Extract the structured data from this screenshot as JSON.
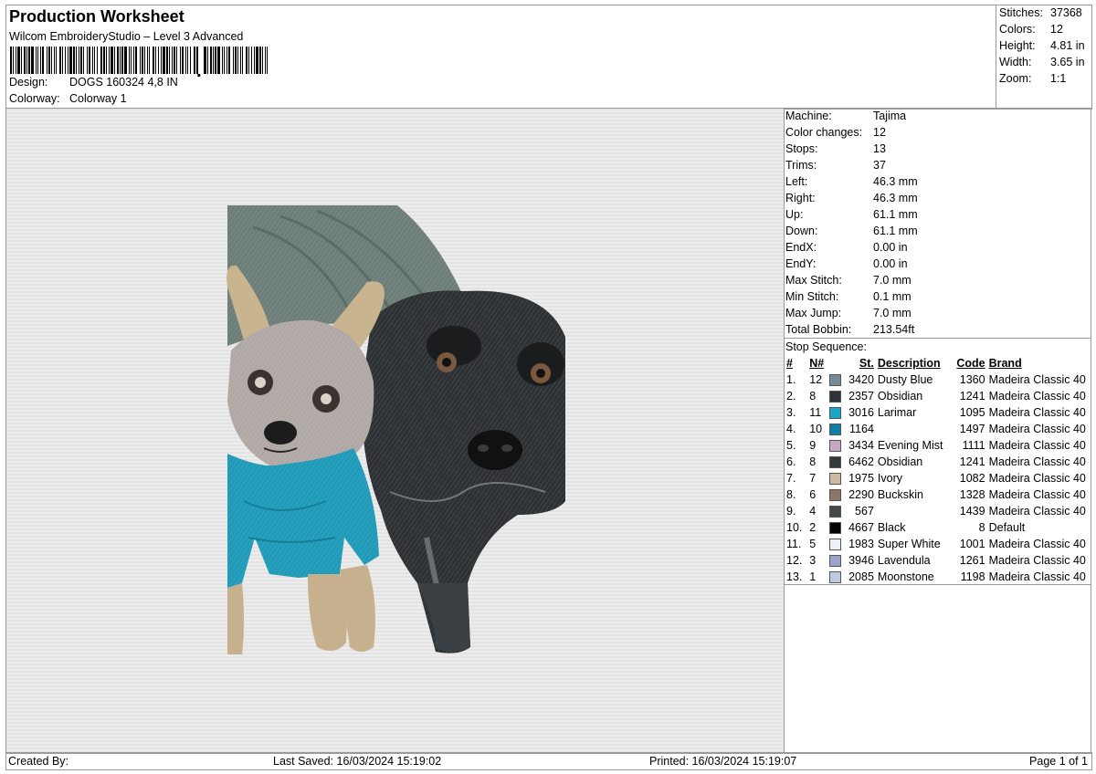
{
  "header": {
    "title": "Production Worksheet",
    "subtitle": "Wilcom EmbroideryStudio – Level 3 Advanced",
    "design_label": "Design:",
    "design_value": "DOGS 160324 4,8 IN",
    "colorway_label": "Colorway:",
    "colorway_value": "Colorway 1"
  },
  "stats": [
    {
      "label": "Stitches:",
      "value": "37368"
    },
    {
      "label": "Colors:",
      "value": "12"
    },
    {
      "label": "Height:",
      "value": "4.81 in"
    },
    {
      "label": "Width:",
      "value": "3.65 in"
    },
    {
      "label": "Zoom:",
      "value": "1:1"
    }
  ],
  "machine": [
    {
      "label": "Machine:",
      "value": "Tajima"
    },
    {
      "label": "Color changes:",
      "value": "12"
    },
    {
      "label": "Stops:",
      "value": "13"
    },
    {
      "label": "Trims:",
      "value": "37"
    },
    {
      "label": "Left:",
      "value": "46.3 mm"
    },
    {
      "label": "Right:",
      "value": "46.3 mm"
    },
    {
      "label": "Up:",
      "value": "61.1 mm"
    },
    {
      "label": "Down:",
      "value": "61.1 mm"
    },
    {
      "label": "EndX:",
      "value": "0.00 in"
    },
    {
      "label": "EndY:",
      "value": "0.00 in"
    },
    {
      "label": "Max Stitch:",
      "value": "7.0 mm"
    },
    {
      "label": "Min Stitch:",
      "value": "0.1 mm"
    },
    {
      "label": "Max Jump:",
      "value": "7.0 mm"
    },
    {
      "label": "Total Bobbin:",
      "value": "213.54ft"
    }
  ],
  "sequence": {
    "title": "Stop Sequence:",
    "headers": {
      "num": "#",
      "n": "N#",
      "st": "St.",
      "desc": "Description",
      "code": "Code",
      "brand": "Brand"
    },
    "rows": [
      {
        "num": "1.",
        "n": "12",
        "color": "#7a8a96",
        "st": "3420",
        "desc": "Dusty Blue",
        "code": "1360",
        "brand": "Madeira Classic 40"
      },
      {
        "num": "2.",
        "n": "8",
        "color": "#2f3436",
        "st": "2357",
        "desc": "Obsidian",
        "code": "1241",
        "brand": "Madeira Classic 40"
      },
      {
        "num": "3.",
        "n": "11",
        "color": "#19a6c7",
        "st": "3016",
        "desc": "Larimar",
        "code": "1095",
        "brand": "Madeira Classic 40"
      },
      {
        "num": "4.",
        "n": "10",
        "color": "#0f7fa6",
        "st": "1164",
        "desc": "",
        "code": "1497",
        "brand": "Madeira Classic 40"
      },
      {
        "num": "5.",
        "n": "9",
        "color": "#c4a8c6",
        "st": "3434",
        "desc": "Evening Mist",
        "code": "1111",
        "brand": "Madeira Classic 40"
      },
      {
        "num": "6.",
        "n": "8",
        "color": "#33383a",
        "st": "6462",
        "desc": "Obsidian",
        "code": "1241",
        "brand": "Madeira Classic 40"
      },
      {
        "num": "7.",
        "n": "7",
        "color": "#cdb8a2",
        "st": "1975",
        "desc": "Ivory",
        "code": "1082",
        "brand": "Madeira Classic 40"
      },
      {
        "num": "8.",
        "n": "6",
        "color": "#8e7666",
        "st": "2290",
        "desc": "Buckskin",
        "code": "1328",
        "brand": "Madeira Classic 40"
      },
      {
        "num": "9.",
        "n": "4",
        "color": "#444848",
        "st": "567",
        "desc": "",
        "code": "1439",
        "brand": "Madeira Classic 40"
      },
      {
        "num": "10.",
        "n": "2",
        "color": "#050505",
        "st": "4667",
        "desc": "Black",
        "code": "8",
        "brand": "Default"
      },
      {
        "num": "11.",
        "n": "5",
        "color": "#eef1f8",
        "st": "1983",
        "desc": "Super White",
        "code": "1001",
        "brand": "Madeira Classic 40"
      },
      {
        "num": "12.",
        "n": "3",
        "color": "#9aa3cc",
        "st": "3946",
        "desc": "Lavendula",
        "code": "1261",
        "brand": "Madeira Classic 40"
      },
      {
        "num": "13.",
        "n": "1",
        "color": "#bccbe0",
        "st": "2085",
        "desc": "Moonstone",
        "code": "1198",
        "brand": "Madeira Classic 40"
      }
    ]
  },
  "footer": {
    "created_by": "Created By:",
    "last_saved": "Last Saved: 16/03/2024 15:19:02",
    "printed": "Printed: 16/03/2024 15:19:07",
    "page": "Page 1 of 1"
  }
}
